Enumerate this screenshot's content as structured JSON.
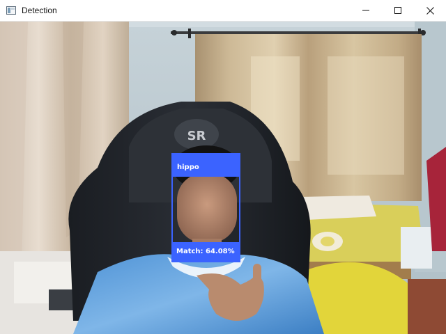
{
  "window": {
    "title": "Detection",
    "icon": "app-window-icon",
    "controls": [
      "minimize-icon",
      "maximize-icon",
      "close-icon"
    ]
  },
  "detection": {
    "name": "hippo",
    "match_label": "Match: 64.08%",
    "match_percent": 64.08,
    "box_color": "#3b63ff"
  }
}
